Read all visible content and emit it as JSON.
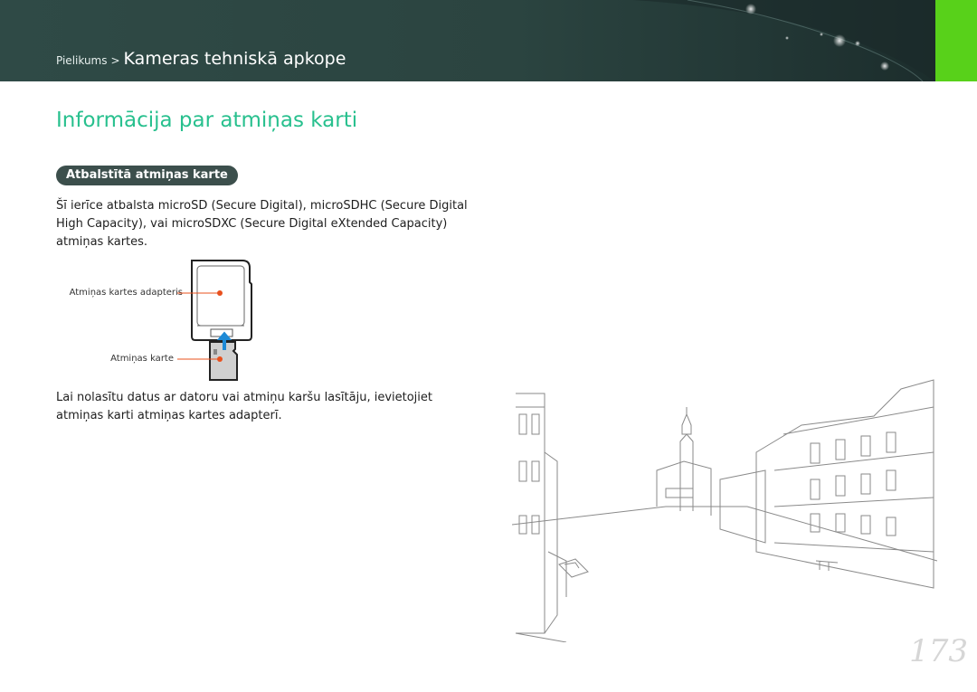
{
  "header": {
    "breadcrumb_parent": "Pielikums",
    "breadcrumb_separator": ">",
    "breadcrumb_current": "Kameras tehniskā apkope",
    "accent_color": "#58d11a",
    "bar_color": "#2f4a46"
  },
  "main": {
    "title": "Informācija par atmiņas karti",
    "section_label": "Atbalstītā atmiņas karte",
    "paragraph_1": "Šī ierīce atbalsta microSD (Secure Digital), microSDHC (Secure Digital High Capacity), vai microSDXC (Secure Digital eXtended Capacity) atmiņas kartes.",
    "paragraph_2": "Lai nolasītu datus ar datoru vai atmiņu karšu lasītāju, ievietojiet atmiņas karti atmiņas kartes adapterī.",
    "title_color": "#28c08e"
  },
  "diagram": {
    "adapter_label": "Atmiņas kartes adapteris",
    "card_label": "Atmiņas karte",
    "callout_color": "#e8501d",
    "arrow_color": "#1e8ad6"
  },
  "footer": {
    "page_number": "173"
  }
}
